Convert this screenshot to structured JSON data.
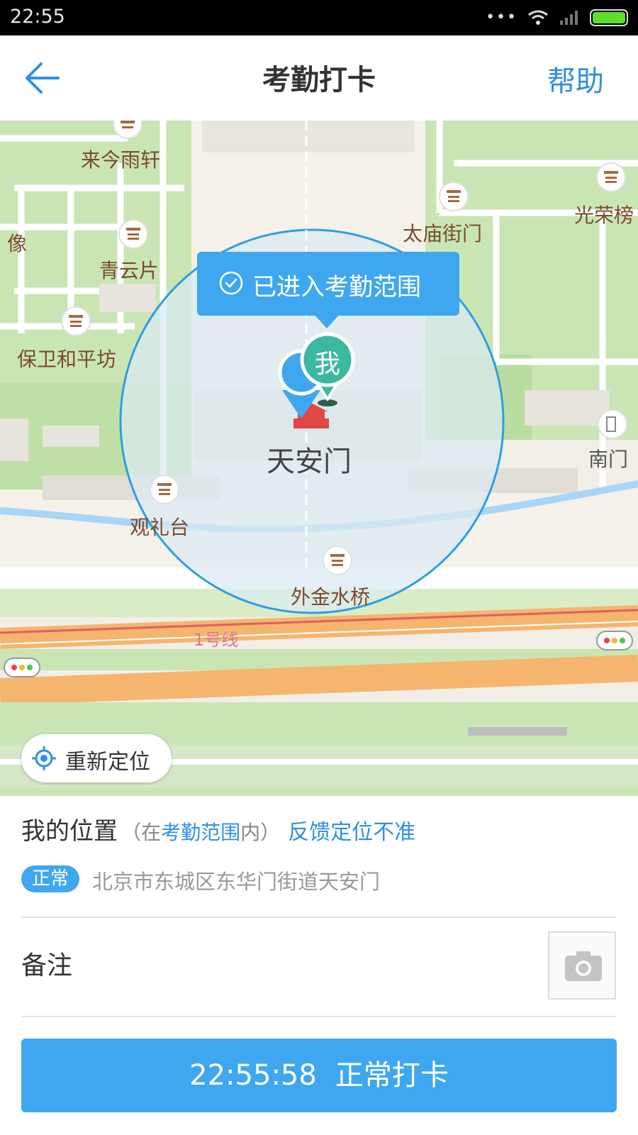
{
  "status_bar": {
    "time": "22:55",
    "dots": "•••"
  },
  "header": {
    "title": "考勤打卡",
    "help_label": "帮助"
  },
  "map": {
    "places": [
      {
        "id": "laijinyuxuan",
        "label": "来今雨轩"
      },
      {
        "id": "qingyunpian",
        "label": "青云片"
      },
      {
        "id": "xiang",
        "label": "像"
      },
      {
        "id": "baowei",
        "label": "保卫和平坊"
      },
      {
        "id": "taimiao",
        "label": "太庙街门"
      },
      {
        "id": "guangrong",
        "label": "光荣榜"
      },
      {
        "id": "tiananmen",
        "label": "天安门"
      },
      {
        "id": "nanmen",
        "label": "南门"
      },
      {
        "id": "guanlitai",
        "label": "观礼台"
      },
      {
        "id": "waijinshuiqiao",
        "label": "外金水桥"
      }
    ],
    "subway_label": "1号线",
    "bubble_text": "已进入考勤范围",
    "marker_me": "我",
    "relocate_label": "重新定位"
  },
  "location": {
    "title": "我的位置",
    "paren_open": "（在",
    "range": "考勤范围",
    "paren_close": "内）",
    "feedback": "反馈定位不准",
    "status_badge": "正常",
    "address": "北京市东城区东华门街道天安门"
  },
  "remark": {
    "label": "备注"
  },
  "punch": {
    "time": "22:55:58",
    "label": "正常打卡"
  },
  "colors": {
    "accent": "#3fa7ef",
    "link": "#2d8fe5",
    "marker_green": "#3bb9a0"
  }
}
